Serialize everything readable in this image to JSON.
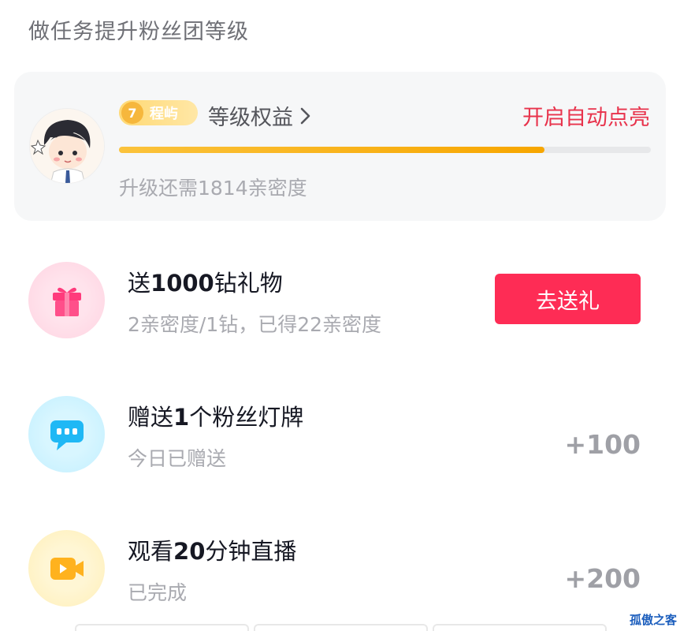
{
  "page": {
    "title": "做任务提升粉丝团等级"
  },
  "level_card": {
    "badge_level": "7",
    "badge_name": "程屿",
    "benefits_label": "等级权益",
    "auto_light_label": "开启自动点亮",
    "progress_fraction": 0.8,
    "upgrade_hint": "升级还需1814亲密度"
  },
  "tasks": [
    {
      "title_prefix": "送",
      "title_bold": "1000",
      "title_suffix": "钻礼物",
      "subtitle": "2亲密度/1钻，已得22亲密度",
      "action_label": "去送礼",
      "icon": "gift-icon"
    },
    {
      "title_prefix": "赠送",
      "title_bold": "1",
      "title_suffix": "个粉丝灯牌",
      "subtitle": "今日已赠送",
      "reward": "+100",
      "icon": "message-icon"
    },
    {
      "title_prefix": "观看",
      "title_bold": "20",
      "title_suffix": "分钟直播",
      "subtitle": "已完成",
      "reward": "+200",
      "icon": "video-camera-icon"
    }
  ],
  "colors": {
    "accent": "#fe2c55",
    "progress": "#f7a600",
    "auto_light": "#e8334c"
  },
  "watermark": "孤傲之客"
}
